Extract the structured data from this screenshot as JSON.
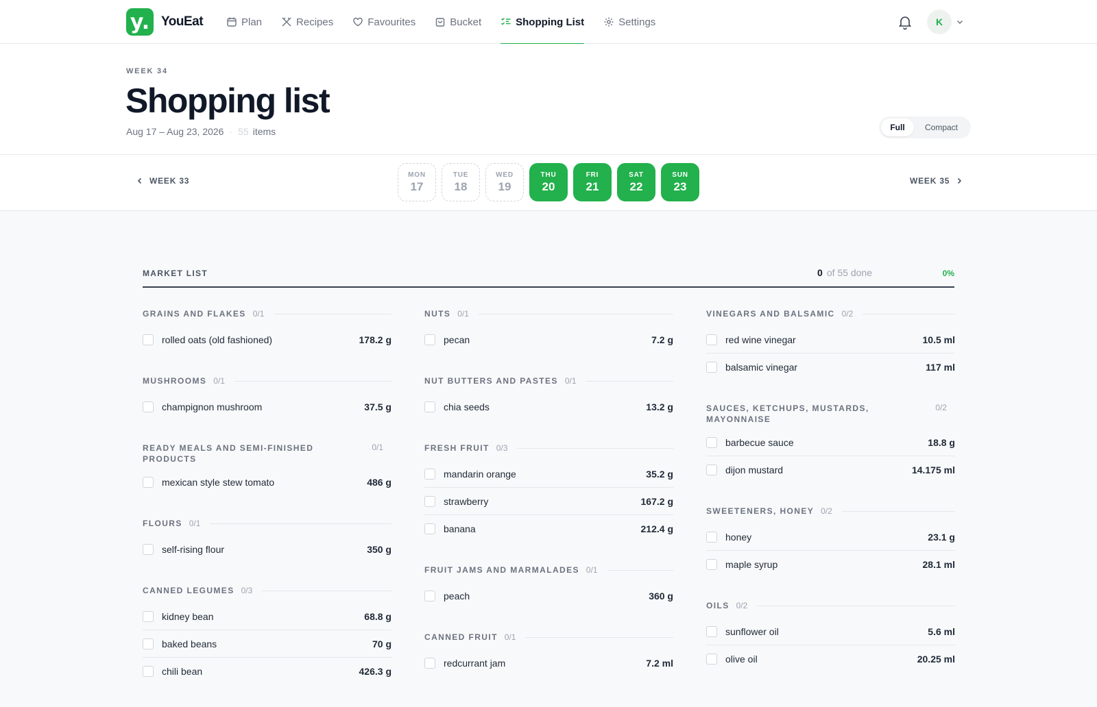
{
  "app": {
    "name": "YouEat",
    "logo_letter": "y."
  },
  "nav": [
    {
      "label": "Plan",
      "icon": "calendar-icon",
      "active": false
    },
    {
      "label": "Recipes",
      "icon": "utensils-icon",
      "active": false
    },
    {
      "label": "Favourites",
      "icon": "heart-icon",
      "active": false
    },
    {
      "label": "Bucket",
      "icon": "bag-icon",
      "active": false
    },
    {
      "label": "Shopping List",
      "icon": "checklist-icon",
      "active": true
    },
    {
      "label": "Settings",
      "icon": "gear-icon",
      "active": false
    }
  ],
  "user": {
    "initial": "K"
  },
  "header": {
    "week_label": "WEEK 34",
    "title": "Shopping list",
    "date_range": "Aug 17 – Aug 23, 2026",
    "item_count": "55",
    "items_label": "items",
    "view_toggle": {
      "full": "Full",
      "compact": "Compact",
      "selected": "Full"
    }
  },
  "daystrip": {
    "prev_week": "WEEK 33",
    "next_week": "WEEK 35",
    "days": [
      {
        "name": "MON",
        "date": "17",
        "state": "past"
      },
      {
        "name": "TUE",
        "date": "18",
        "state": "past"
      },
      {
        "name": "WED",
        "date": "19",
        "state": "past"
      },
      {
        "name": "THU",
        "date": "20",
        "state": "active"
      },
      {
        "name": "FRI",
        "date": "21",
        "state": "active"
      },
      {
        "name": "SAT",
        "date": "22",
        "state": "active"
      },
      {
        "name": "SUN",
        "date": "23",
        "state": "active"
      }
    ]
  },
  "market": {
    "title": "MARKET LIST",
    "done_count": "0",
    "done_text": "of 55 done",
    "percent": "0%",
    "columns": [
      [
        {
          "name": "GRAINS AND FLAKES",
          "count": "0/1",
          "items": [
            {
              "name": "rolled oats (old fashioned)",
              "qty": "178.2 g"
            }
          ]
        },
        {
          "name": "MUSHROOMS",
          "count": "0/1",
          "items": [
            {
              "name": "champignon mushroom",
              "qty": "37.5 g"
            }
          ]
        },
        {
          "name": "READY MEALS AND SEMI-FINISHED PRODUCTS",
          "count": "0/1",
          "two_line": true,
          "items": [
            {
              "name": "mexican style stew tomato",
              "qty": "486 g"
            }
          ]
        },
        {
          "name": "FLOURS",
          "count": "0/1",
          "items": [
            {
              "name": "self-rising flour",
              "qty": "350 g"
            }
          ]
        },
        {
          "name": "CANNED LEGUMES",
          "count": "0/3",
          "items": [
            {
              "name": "kidney bean",
              "qty": "68.8 g"
            },
            {
              "name": "baked beans",
              "qty": "70 g"
            },
            {
              "name": "chili bean",
              "qty": "426.3 g"
            }
          ]
        }
      ],
      [
        {
          "name": "NUTS",
          "count": "0/1",
          "items": [
            {
              "name": "pecan",
              "qty": "7.2 g"
            }
          ]
        },
        {
          "name": "NUT BUTTERS AND PASTES",
          "count": "0/1",
          "items": [
            {
              "name": "chia seeds",
              "qty": "13.2 g"
            }
          ]
        },
        {
          "name": "FRESH FRUIT",
          "count": "0/3",
          "items": [
            {
              "name": "mandarin orange",
              "qty": "35.2 g"
            },
            {
              "name": "strawberry",
              "qty": "167.2 g"
            },
            {
              "name": "banana",
              "qty": "212.4 g"
            }
          ]
        },
        {
          "name": "FRUIT JAMS AND MARMALADES",
          "count": "0/1",
          "items": [
            {
              "name": "peach",
              "qty": "360 g"
            }
          ]
        },
        {
          "name": "CANNED FRUIT",
          "count": "0/1",
          "items": [
            {
              "name": "redcurrant jam",
              "qty": "7.2 ml"
            }
          ]
        }
      ],
      [
        {
          "name": "VINEGARS AND BALSAMIC",
          "count": "0/2",
          "items": [
            {
              "name": "red wine vinegar",
              "qty": "10.5 ml"
            },
            {
              "name": "balsamic vinegar",
              "qty": "117 ml"
            }
          ]
        },
        {
          "name": "SAUCES, KETCHUPS, MUSTARDS, MAYONNAISE",
          "count": "0/2",
          "two_line": true,
          "items": [
            {
              "name": "barbecue sauce",
              "qty": "18.8 g"
            },
            {
              "name": "dijon mustard",
              "qty": "14.175 ml"
            }
          ]
        },
        {
          "name": "SWEETENERS, HONEY",
          "count": "0/2",
          "items": [
            {
              "name": "honey",
              "qty": "23.1 g"
            },
            {
              "name": "maple syrup",
              "qty": "28.1 ml"
            }
          ]
        },
        {
          "name": "OILS",
          "count": "0/2",
          "items": [
            {
              "name": "sunflower oil",
              "qty": "5.6 ml"
            },
            {
              "name": "olive oil",
              "qty": "20.25 ml"
            }
          ]
        }
      ]
    ]
  },
  "colors": {
    "accent": "#22b14c",
    "text": "#111827",
    "muted": "#6b7280",
    "border": "#e5e7eb"
  }
}
